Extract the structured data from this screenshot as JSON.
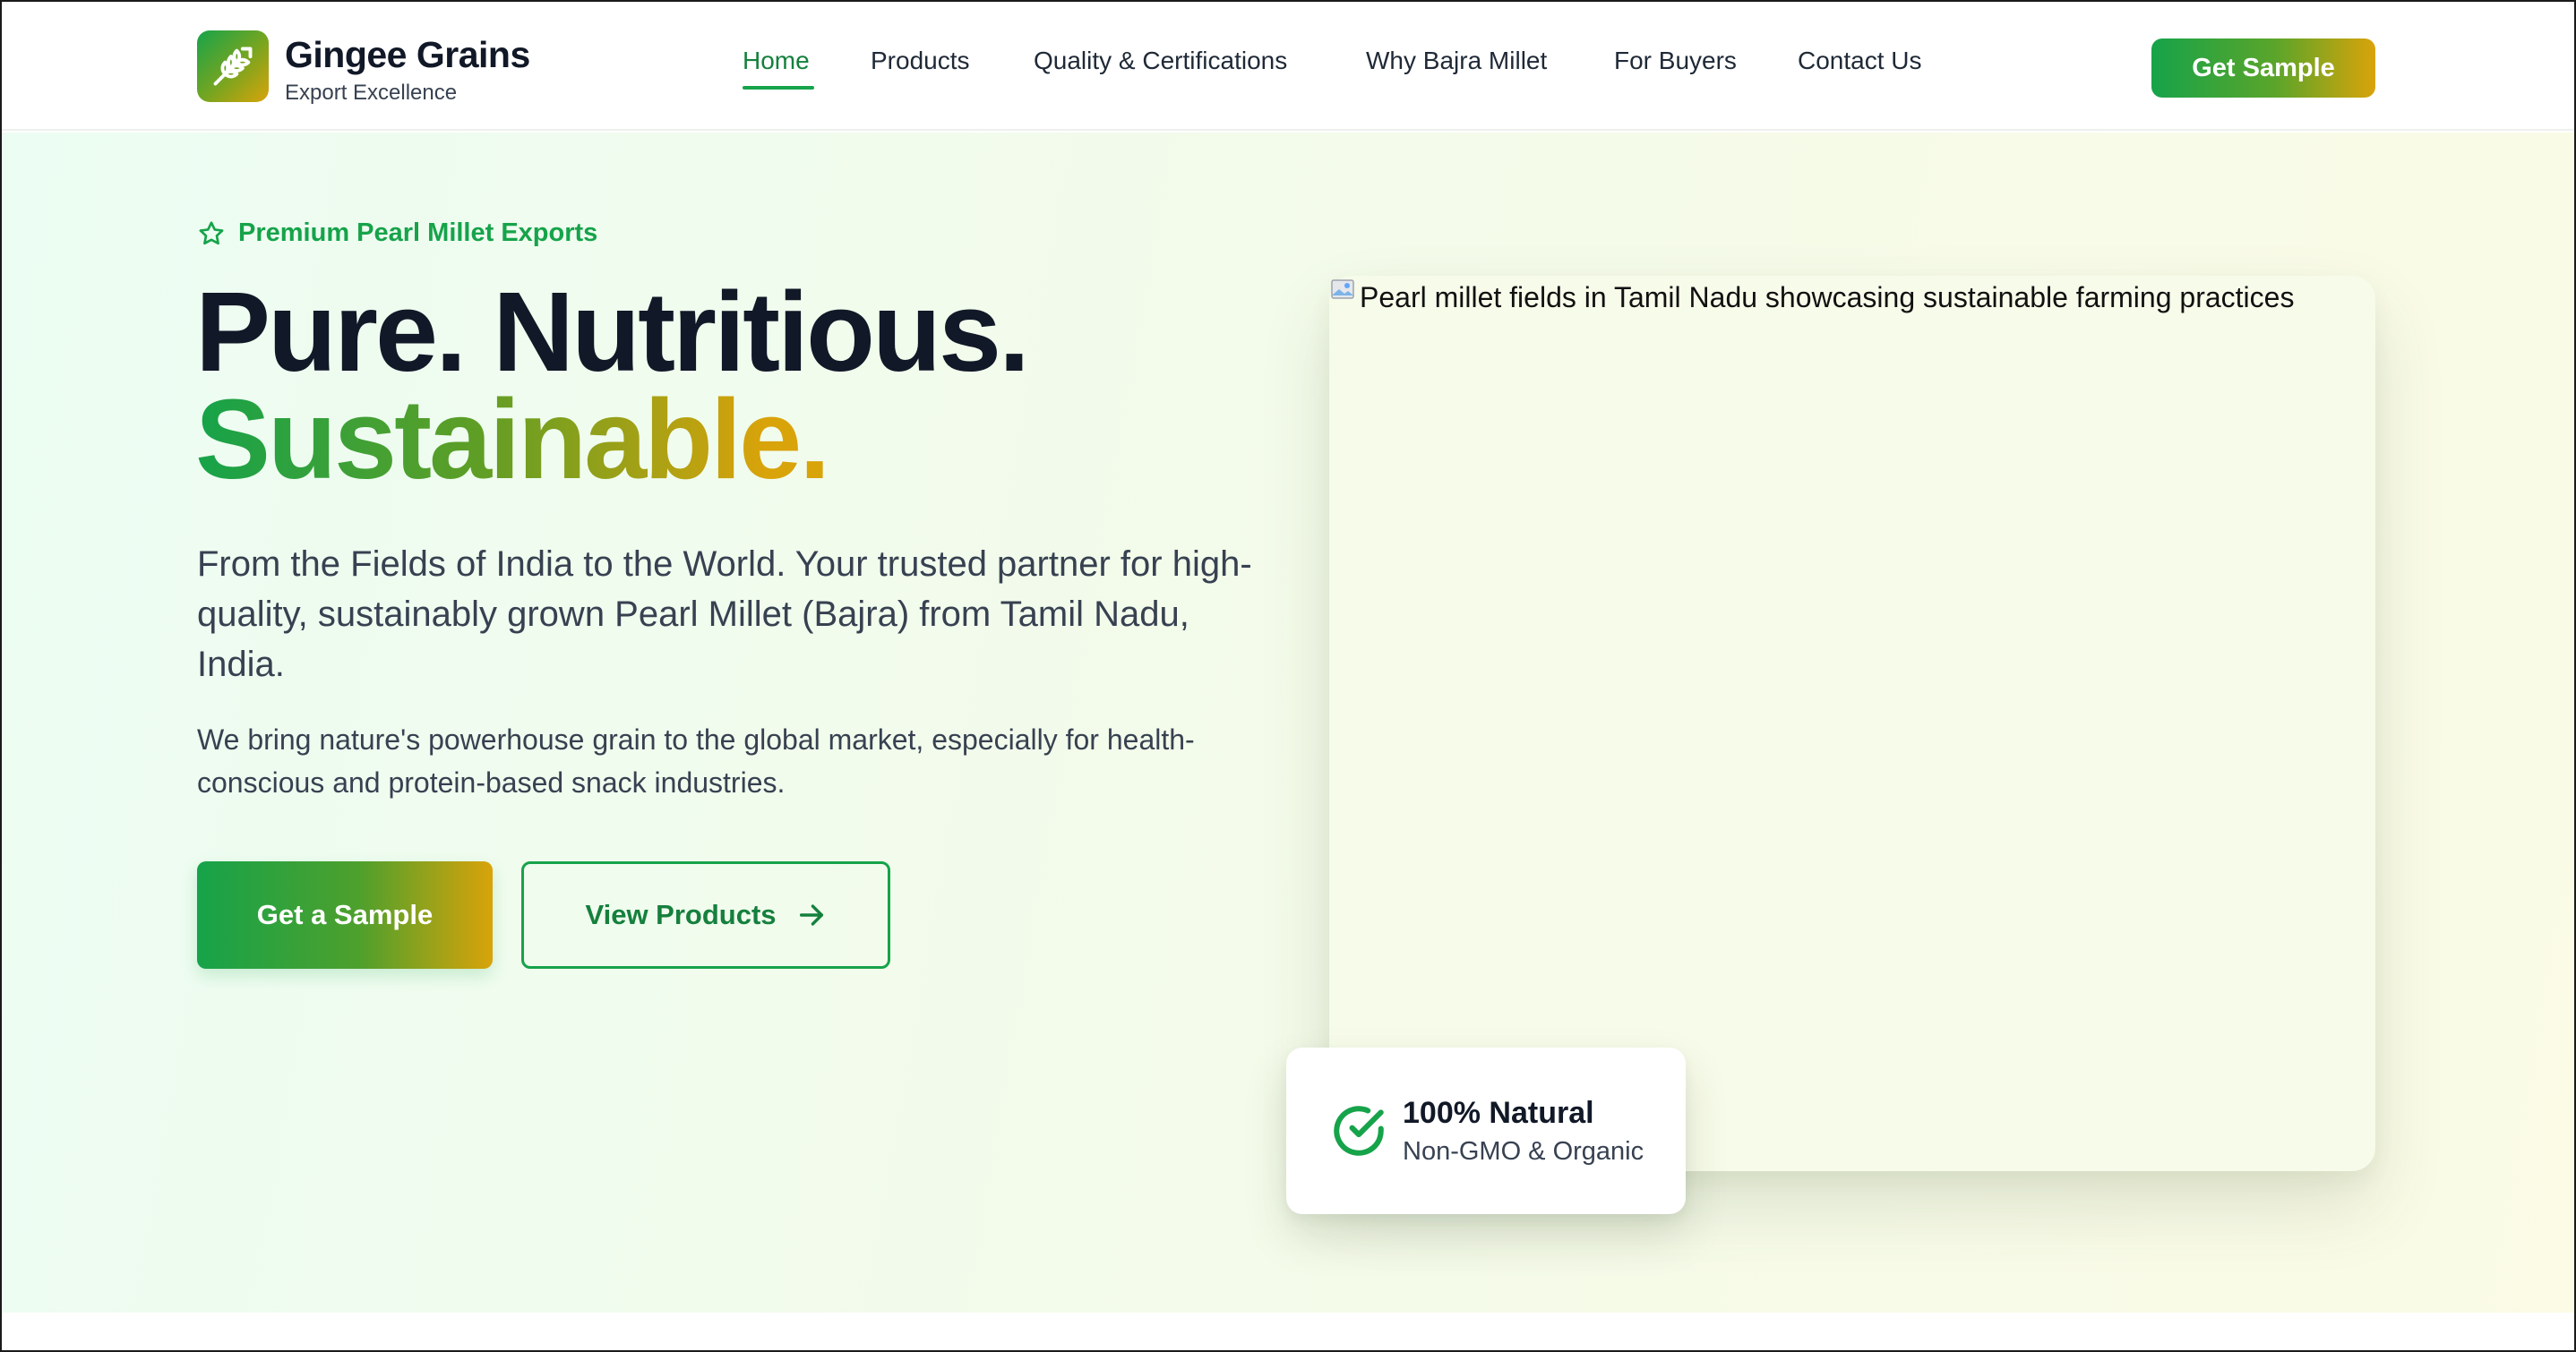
{
  "brand": {
    "name": "Gingee Grains",
    "tagline": "Export Excellence",
    "logo_icon": "wheat-icon"
  },
  "nav": {
    "items": [
      {
        "label": "Home",
        "active": true
      },
      {
        "label": "Products",
        "active": false
      },
      {
        "label": "Quality & Certifications",
        "active": false
      },
      {
        "label": "Why Bajra Millet",
        "active": false
      },
      {
        "label": "For Buyers",
        "active": false
      },
      {
        "label": "Contact Us",
        "active": false
      }
    ],
    "cta_label": "Get Sample"
  },
  "hero": {
    "eyebrow": "Premium Pearl Millet Exports",
    "eyebrow_icon": "star-icon",
    "headline_line1": "Pure. Nutritious.",
    "headline_line2": "Sustainable.",
    "lead": "From the Fields of India to the World. Your trusted partner for high-quality, sustainably grown Pearl Millet (Bajra) from Tamil Nadu, India.",
    "sub": "We bring nature's powerhouse grain to the global market, especially for health-conscious and protein-based snack industries.",
    "primary_button": "Get a Sample",
    "secondary_button": "View Products",
    "secondary_icon": "arrow-right-icon",
    "image_alt": "Pearl millet fields in Tamil Nadu showcasing sustainable farming practices"
  },
  "badge": {
    "title": "100% Natural",
    "subtitle": "Non-GMO & Organic",
    "icon": "check-circle-icon"
  },
  "colors": {
    "brand_green": "#16a34a",
    "brand_gold": "#d9a30a",
    "text_dark": "#111827"
  }
}
